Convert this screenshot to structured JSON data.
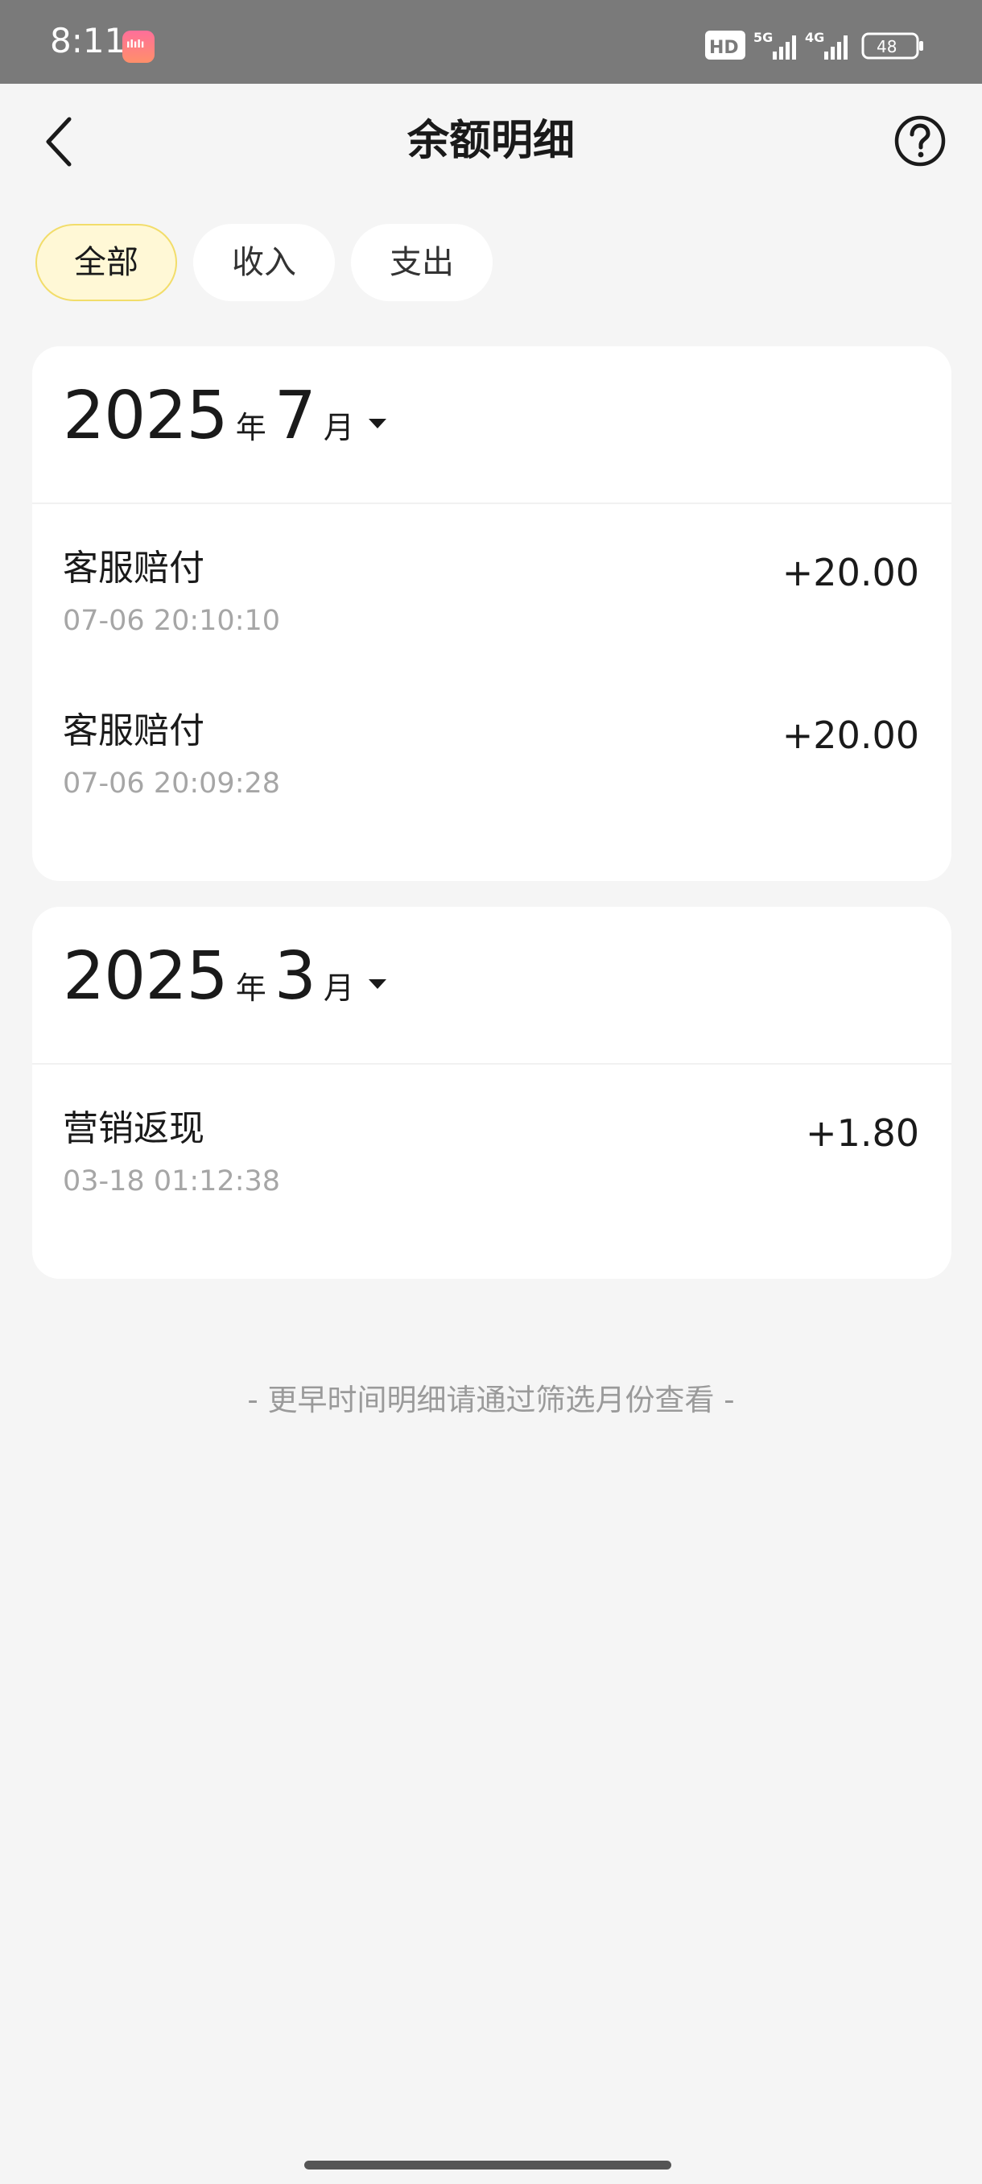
{
  "status_bar": {
    "time": "8:11",
    "app_icon": "bilibili-icon",
    "indicators": [
      "hd-voice-icon",
      "5g-signal-icon",
      "4g-signal-icon",
      "battery-icon"
    ],
    "network_5g": "5G",
    "network_4g": "4G",
    "hd_label": "HD",
    "battery": "48"
  },
  "nav": {
    "back_icon": "chevron-left-icon",
    "title": "余额明细",
    "help_icon": "question-circle-icon"
  },
  "tabs": [
    {
      "label": "全部",
      "active": true
    },
    {
      "label": "收入",
      "active": false
    },
    {
      "label": "支出",
      "active": false
    }
  ],
  "months": [
    {
      "year": "2025",
      "year_unit": "年",
      "month": "7",
      "month_unit": "月",
      "items": [
        {
          "title": "客服赔付",
          "time": "07-06 20:10:10",
          "amount": "+20.00"
        },
        {
          "title": "客服赔付",
          "time": "07-06 20:09:28",
          "amount": "+20.00"
        }
      ]
    },
    {
      "year": "2025",
      "year_unit": "年",
      "month": "3",
      "month_unit": "月",
      "items": [
        {
          "title": "营销返现",
          "time": "03-18 01:12:38",
          "amount": "+1.80"
        }
      ]
    }
  ],
  "footer_note": "- 更早时间明细请通过筛选月份查看 -",
  "colors": {
    "accent_tab_bg": "#fff8d6",
    "accent_tab_border": "#f2dd6a",
    "page_bg": "#f5f5f5",
    "status_bar_bg": "#7a7a7a"
  }
}
